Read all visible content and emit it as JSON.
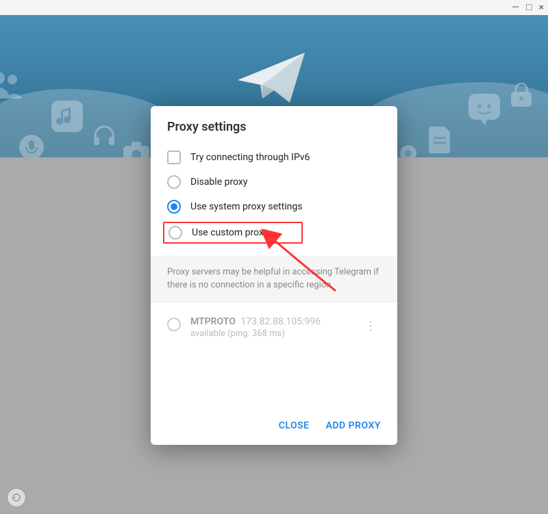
{
  "window": {
    "minimize": "—",
    "maximize": "□",
    "close": "×"
  },
  "modal": {
    "title": "Proxy settings",
    "options": {
      "ipv6": "Try connecting through IPv6",
      "disable": "Disable proxy",
      "system": "Use system proxy settings",
      "custom": "Use custom proxy"
    },
    "info": "Proxy servers may be helpful in accessing Telegram if there is no connection in a specific region.",
    "proxies": [
      {
        "name": "MTPROTO",
        "address": "173.82.88.105:996",
        "status": "available (ping: 368 ms)"
      }
    ],
    "footer": {
      "close": "CLOSE",
      "add": "ADD PROXY"
    }
  }
}
